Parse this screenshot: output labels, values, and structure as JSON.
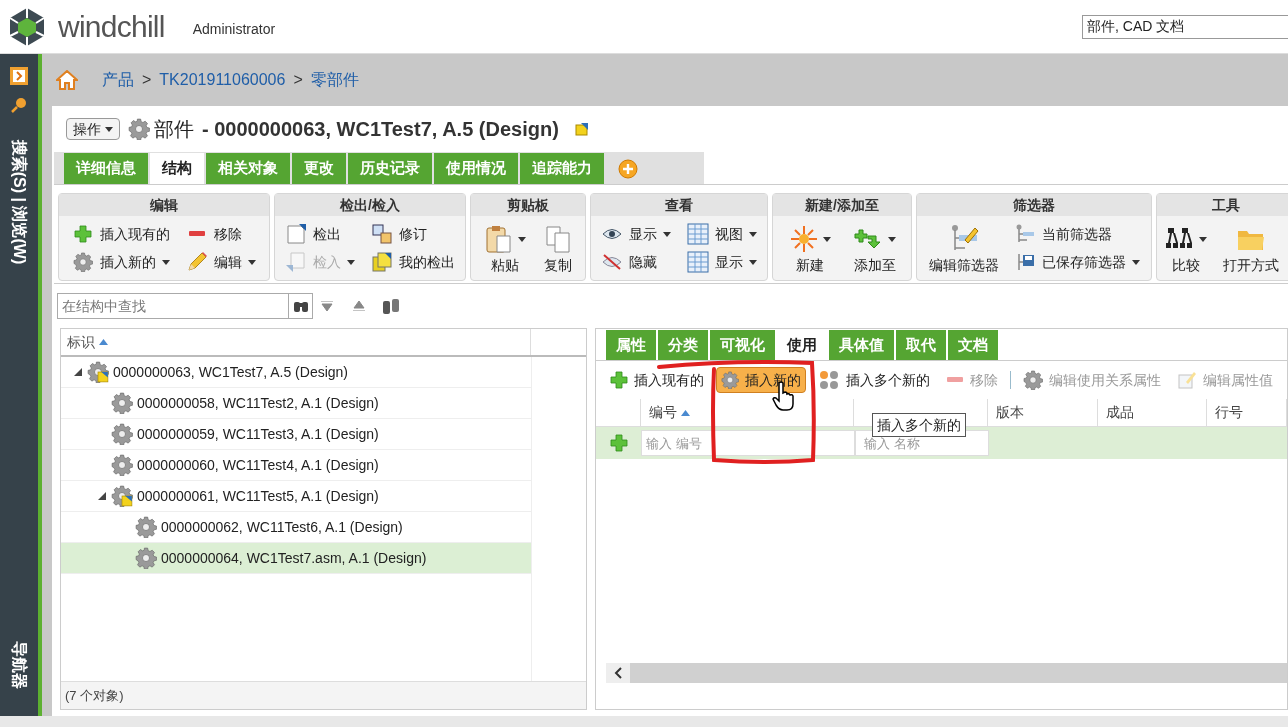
{
  "header": {
    "product": "windchill",
    "user": "Administrator",
    "search_value": "部件, CAD 文档"
  },
  "sidebar": {
    "search_label": "搜索(S) | 浏览(W)",
    "navigator_label": "导航器"
  },
  "breadcrumb": {
    "items": [
      "产品",
      "TK201911060006",
      "零部件"
    ],
    "separator": ">"
  },
  "title": {
    "actions": "操作",
    "type": "部件",
    "name": "- 0000000063, WC1Test7, A.5 (Design)"
  },
  "tabs": [
    {
      "label": "详细信息",
      "selected": false
    },
    {
      "label": "结构",
      "selected": true
    },
    {
      "label": "相关对象",
      "selected": false
    },
    {
      "label": "更改",
      "selected": false
    },
    {
      "label": "历史记录",
      "selected": false
    },
    {
      "label": "使用情况",
      "selected": false
    },
    {
      "label": "追踪能力",
      "selected": false
    }
  ],
  "toolbar_groups": [
    {
      "title": "编辑",
      "items": [
        {
          "label": "插入现有的",
          "kind": "small",
          "dropdown": false,
          "disabled": false
        },
        {
          "label": "插入新的",
          "kind": "small",
          "dropdown": true,
          "disabled": false
        },
        {
          "label": "移除",
          "kind": "small",
          "dropdown": false,
          "disabled": false
        },
        {
          "label": "编辑",
          "kind": "small",
          "dropdown": true,
          "disabled": false
        }
      ]
    },
    {
      "title": "检出/检入",
      "items": [
        {
          "label": "检出",
          "kind": "small",
          "dropdown": false,
          "disabled": false
        },
        {
          "label": "检入",
          "kind": "small",
          "dropdown": true,
          "disabled": true
        },
        {
          "label": "修订",
          "kind": "small",
          "dropdown": false,
          "disabled": false
        },
        {
          "label": "我的检出",
          "kind": "small",
          "dropdown": false,
          "disabled": false
        }
      ]
    },
    {
      "title": "剪贴板",
      "items": [
        {
          "label": "粘贴",
          "kind": "large",
          "dropdown": true,
          "disabled": false
        },
        {
          "label": "复制",
          "kind": "large",
          "dropdown": false,
          "disabled": false
        }
      ]
    },
    {
      "title": "查看",
      "items": [
        {
          "label": "显示",
          "kind": "small",
          "dropdown": true,
          "disabled": false
        },
        {
          "label": "隐藏",
          "kind": "small",
          "dropdown": false,
          "disabled": false
        },
        {
          "label": "视图",
          "kind": "small",
          "dropdown": true,
          "disabled": false
        },
        {
          "label": "显示",
          "kind": "small",
          "dropdown": true,
          "disabled": false
        }
      ]
    },
    {
      "title": "新建/添加至",
      "items": [
        {
          "label": "新建",
          "kind": "large",
          "dropdown": true,
          "disabled": false
        },
        {
          "label": "添加至",
          "kind": "large",
          "dropdown": true,
          "disabled": false
        }
      ]
    },
    {
      "title": "筛选器",
      "items": [
        {
          "label": "编辑筛选器",
          "kind": "large",
          "dropdown": false,
          "disabled": false
        },
        {
          "label": "当前筛选器",
          "kind": "small",
          "dropdown": false,
          "disabled": false
        },
        {
          "label": "已保存筛选器",
          "kind": "small",
          "dropdown": true,
          "disabled": false
        }
      ]
    },
    {
      "title": "工具",
      "items": [
        {
          "label": "比较",
          "kind": "large",
          "dropdown": true,
          "disabled": false
        },
        {
          "label": "打开方式",
          "kind": "large",
          "dropdown": false,
          "disabled": false
        }
      ]
    }
  ],
  "structure_search": {
    "placeholder": "在结构中查找"
  },
  "tree": {
    "column": {
      "label": "标识",
      "sorted": true
    },
    "items": [
      {
        "label": "0000000063, WC1Test7, A.5 (Design)",
        "kind": "assembly",
        "expanded": true,
        "selected": false,
        "children": [
          {
            "label": "0000000058, WC11Test2, A.1 (Design)",
            "kind": "part",
            "selected": false
          },
          {
            "label": "0000000059, WC11Test3, A.1 (Design)",
            "kind": "part",
            "selected": false
          },
          {
            "label": "0000000060, WC11Test4, A.1 (Design)",
            "kind": "part",
            "selected": false
          },
          {
            "label": "0000000061, WC11Test5, A.1 (Design)",
            "kind": "assembly",
            "expanded": true,
            "selected": false,
            "children": [
              {
                "label": "0000000062, WC11Test6, A.1 (Design)",
                "kind": "part",
                "selected": false
              },
              {
                "label": "0000000064, WC1Test7.asm, A.1 (Design)",
                "kind": "part",
                "selected": true
              }
            ]
          }
        ]
      }
    ],
    "footer": "(7 个对象)"
  },
  "detail_tabs": [
    {
      "label": "属性",
      "selected": false
    },
    {
      "label": "分类",
      "selected": false
    },
    {
      "label": "可视化",
      "selected": false
    },
    {
      "label": "使用",
      "selected": true
    },
    {
      "label": "具体值",
      "selected": false
    },
    {
      "label": "取代",
      "selected": false
    },
    {
      "label": "文档",
      "selected": false
    }
  ],
  "usage_toolbar": [
    {
      "label": "插入现有的",
      "disabled": false,
      "highlighted": false
    },
    {
      "label": "插入新的",
      "disabled": false,
      "highlighted": true
    },
    {
      "label": "插入多个新的",
      "disabled": false,
      "highlighted": false
    },
    {
      "label": "移除",
      "disabled": true,
      "highlighted": false
    },
    {
      "label": "编辑使用关系属性",
      "disabled": true,
      "highlighted": false
    },
    {
      "label": "编辑属性值",
      "disabled": true,
      "highlighted": false
    }
  ],
  "usage_table": {
    "columns": [
      {
        "label": "编号",
        "sorted": true
      },
      {
        "sorted": false
      },
      {
        "label": "版本",
        "sorted": false
      },
      {
        "label": "成品",
        "sorted": false
      },
      {
        "label": "行号",
        "sorted": false
      }
    ],
    "new_row": {
      "number_placeholder": "输入 编号",
      "name_placeholder": "输入 名称"
    }
  },
  "tooltip": "插入多个新的"
}
